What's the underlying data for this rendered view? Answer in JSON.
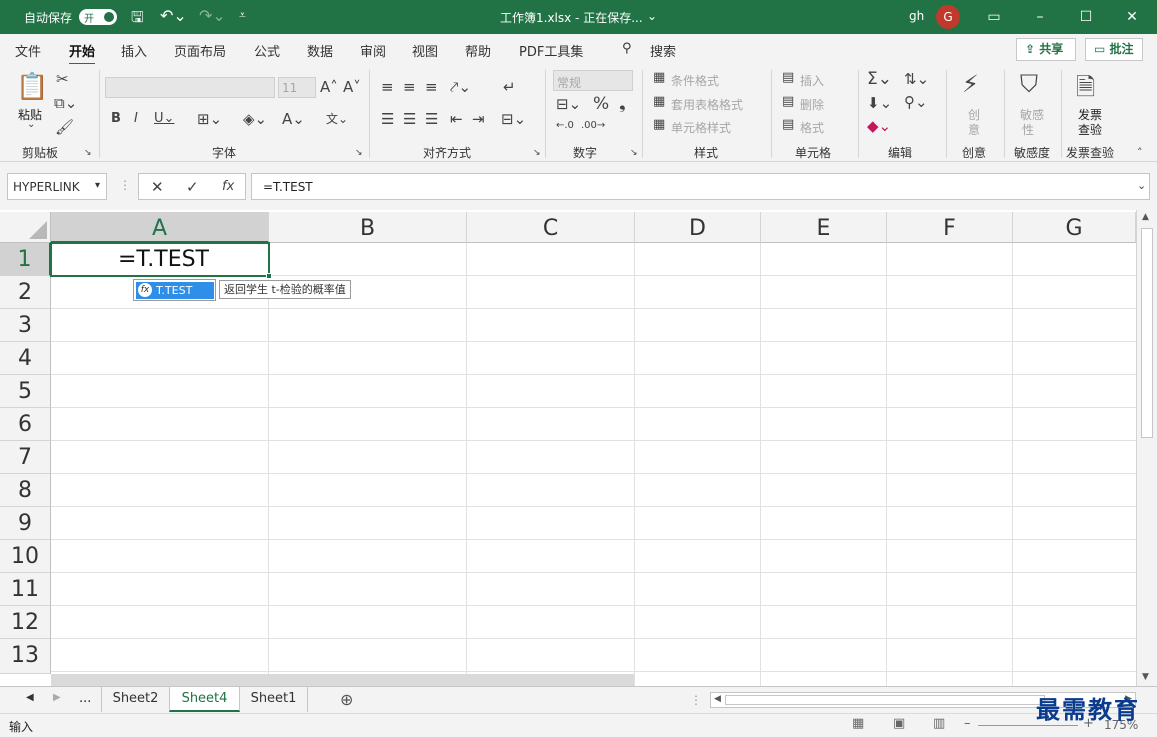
{
  "titlebar": {
    "autosave_label": "自动保存",
    "autosave_state": "开",
    "title": "工作簿1.xlsx  -  正在保存...",
    "user": "gh",
    "avatar_initial": "G"
  },
  "tabs": [
    "文件",
    "开始",
    "插入",
    "页面布局",
    "公式",
    "数据",
    "审阅",
    "视图",
    "帮助",
    "PDF工具集"
  ],
  "search_label": "搜索",
  "share_label": "共享",
  "comment_label": "批注",
  "ribbon": {
    "paste_label": "粘贴",
    "clipboard_group": "剪贴板",
    "font_group": "字体",
    "font_size": "11",
    "alignment_group": "对齐方式",
    "number_group": "数字",
    "number_format": "常规",
    "styles_group": "样式",
    "conditional_format": "条件格式",
    "table_format": "套用表格格式",
    "cell_styles": "单元格样式",
    "cells_group": "单元格",
    "insert_label": "插入",
    "delete_label": "删除",
    "format_label": "格式",
    "editing_group": "编辑",
    "creative_group": "创意",
    "creative_btn_1": "创",
    "creative_btn_2": "意",
    "sensitivity_group": "敏感度",
    "sensitivity_btn_1": "敏感",
    "sensitivity_btn_2": "性",
    "invoice_group": "发票查验",
    "invoice_btn_1": "发票",
    "invoice_btn_2": "查验"
  },
  "formula_bar": {
    "name_box": "HYPERLINK",
    "formula": "=T.TEST"
  },
  "grid": {
    "columns": [
      "A",
      "B",
      "C",
      "D",
      "E",
      "F",
      "G"
    ],
    "rows": [
      "1",
      "2",
      "3",
      "4",
      "5",
      "6",
      "7",
      "8",
      "9",
      "10",
      "11",
      "12",
      "13"
    ],
    "active_cell_value": "=T.TEST",
    "autocomplete_item": "T.TEST",
    "autocomplete_tip": "返回学生 t-检验的概率值"
  },
  "sheets": {
    "ellipsis": "...",
    "tabs": [
      "Sheet2",
      "Sheet4",
      "Sheet1"
    ],
    "active": "Sheet4"
  },
  "status": {
    "mode": "输入",
    "zoom": "175%"
  },
  "watermark": "最需教育"
}
